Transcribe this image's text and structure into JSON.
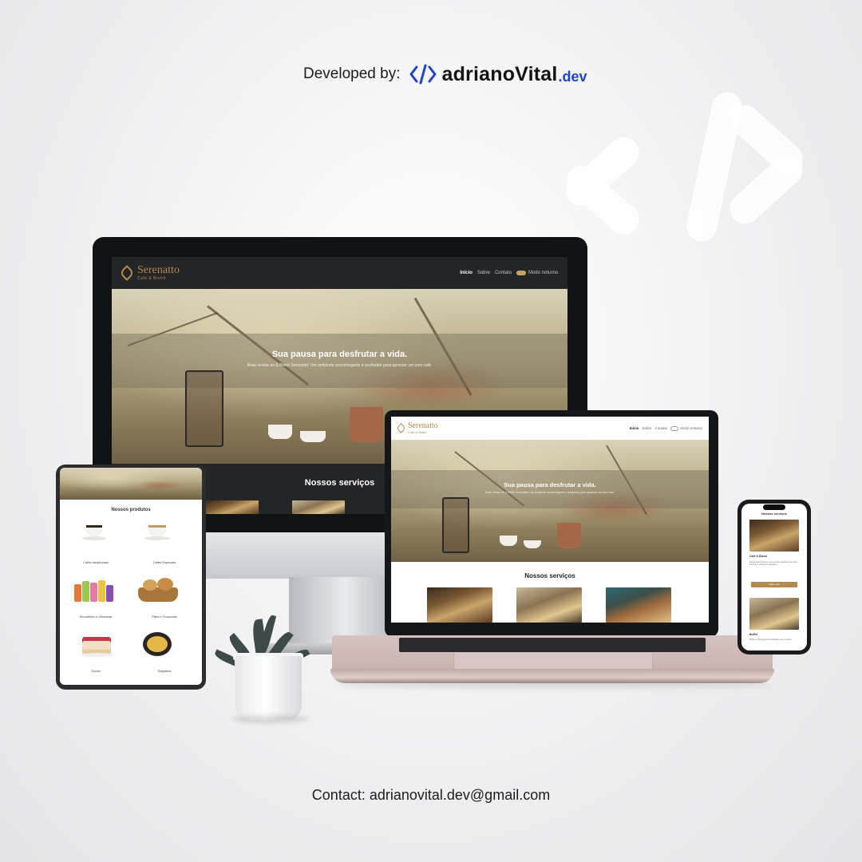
{
  "header": {
    "developed_label": "Developed by:",
    "logo_icon": "code-brackets-icon",
    "logo_name": "adrianoVital",
    "logo_tld": ".dev",
    "accent_color": "#1f45c4"
  },
  "contact": "Contact: adrianovital.dev@gmail.com",
  "site": {
    "brand_name": "Serenatto",
    "brand_sub": "Café & Bistrô",
    "brand_color": "#b38a4d",
    "nav": {
      "inicio": "Início",
      "sobre": "Sobre",
      "contato": "Contato",
      "dark_mode": "Modo noturno"
    },
    "hero_title": "Sua pausa para desfrutar a vida.",
    "hero_text": "Boas-vindas ao & Bistrô Serenatto! Um ambiente aconchegante e acolhedor para apreciar um bom café.",
    "services_title": "Nossos serviços",
    "products_title": "Nossos produtos",
    "products": [
      {
        "label": "Cafés tradicionais"
      },
      {
        "label": "Cafés Especiais"
      },
      {
        "label": "Smoothies e Vitaminas"
      },
      {
        "label": "Pães e Focaccias"
      },
      {
        "label": "Doces"
      },
      {
        "label": "Salgados"
      }
    ],
    "mobile": {
      "section_title": "Nossos serviços",
      "card1_title": "Café & Bistrô",
      "card1_text": "Nosso bistrô oferece uma ampla variedade de cafés, lanches e deliciosos salgados.",
      "card1_button": "Saiba mais",
      "card2_title": "Buffet",
      "card2_text": "Buffet e catering personalizados para eventos."
    }
  }
}
